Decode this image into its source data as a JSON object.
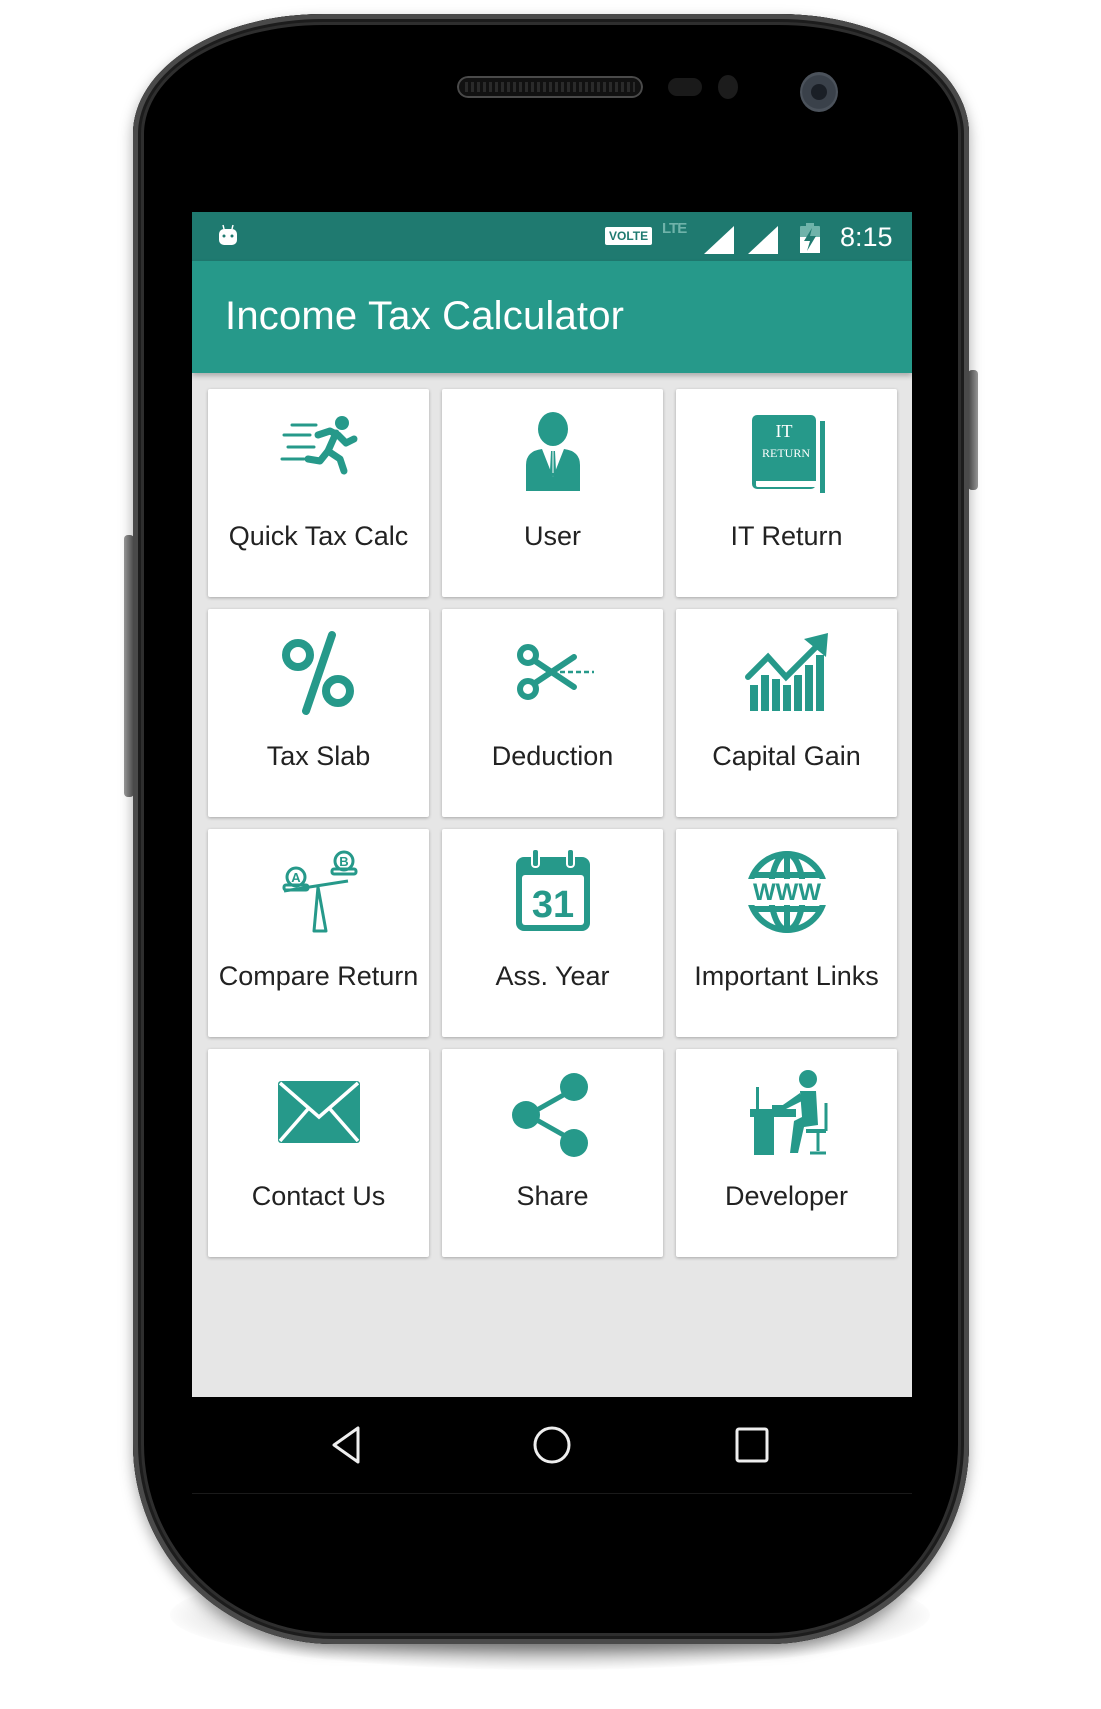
{
  "statusbar": {
    "notification_icon": "android-notification-icon",
    "volte_label": "VOLTE",
    "network_label": "LTE",
    "time": "8:15",
    "colors": {
      "background": "#1f7a70"
    }
  },
  "appbar": {
    "title": "Income Tax Calculator",
    "colors": {
      "background": "#26998a"
    }
  },
  "theme": {
    "accent": "#26998a",
    "card_background": "#ffffff",
    "screen_background": "#e6e6e6",
    "label_color": "#222222"
  },
  "menu": {
    "items": [
      {
        "label": "Quick Tax Calc",
        "icon": "running-man-icon"
      },
      {
        "label": "User",
        "icon": "user-icon"
      },
      {
        "label": "IT Return",
        "icon": "it-return-book-icon",
        "icon_text_1": "IT",
        "icon_text_2": "RETURN"
      },
      {
        "label": "Tax Slab",
        "icon": "percent-icon"
      },
      {
        "label": "Deduction",
        "icon": "scissors-icon"
      },
      {
        "label": "Capital Gain",
        "icon": "growth-chart-icon"
      },
      {
        "label": "Compare Return",
        "icon": "seesaw-compare-icon",
        "icon_text_1": "A",
        "icon_text_2": "B"
      },
      {
        "label": "Ass. Year",
        "icon": "calendar-icon",
        "icon_text_1": "31"
      },
      {
        "label": "Important Links",
        "icon": "globe-www-icon",
        "icon_text_1": "WWW"
      },
      {
        "label": "Contact Us",
        "icon": "envelope-icon"
      },
      {
        "label": "Share",
        "icon": "share-icon"
      },
      {
        "label": "Developer",
        "icon": "developer-desk-icon"
      }
    ]
  },
  "navbar": {
    "back": "back-icon",
    "home": "home-icon",
    "recents": "recents-icon"
  }
}
